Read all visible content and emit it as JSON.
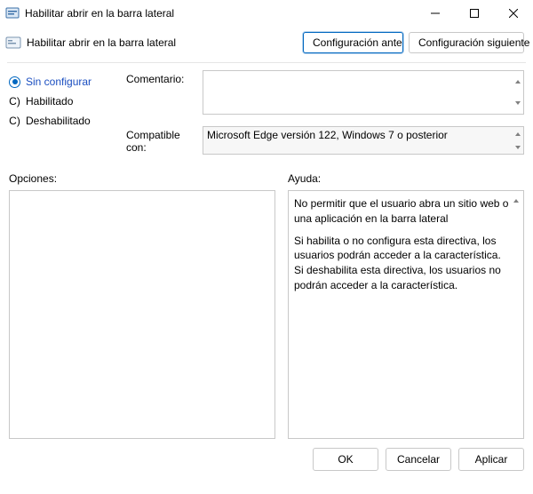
{
  "window": {
    "title": "Habilitar abrir en la barra lateral"
  },
  "header": {
    "title": "Habilitar abrir en la barra lateral",
    "prev_btn": "Configuración anterior",
    "next_btn": "Configuración siguiente"
  },
  "state": {
    "options": [
      {
        "label": "Sin configurar",
        "selected": true
      },
      {
        "label": "Habilitado",
        "selected": false
      },
      {
        "label": "Deshabilitado",
        "selected": false
      }
    ],
    "unselected_prefix": "C)"
  },
  "fields": {
    "comment_label": "Comentario:",
    "comment_value": "",
    "compat_label": "Compatible con:",
    "compat_value": "Microsoft Edge versión 122, Windows 7 o posterior"
  },
  "panels": {
    "options_label": "Opciones:",
    "help_label": "Ayuda:",
    "help_paragraphs": [
      "No permitir que el usuario abra un sitio web o una aplicación en la barra lateral",
      "Si habilita o no configura esta directiva, los usuarios podrán acceder a la característica.",
      "Si deshabilita esta directiva, los usuarios no podrán acceder a la característica."
    ]
  },
  "footer": {
    "ok": "OK",
    "cancel": "Cancelar",
    "apply": "Aplicar"
  }
}
